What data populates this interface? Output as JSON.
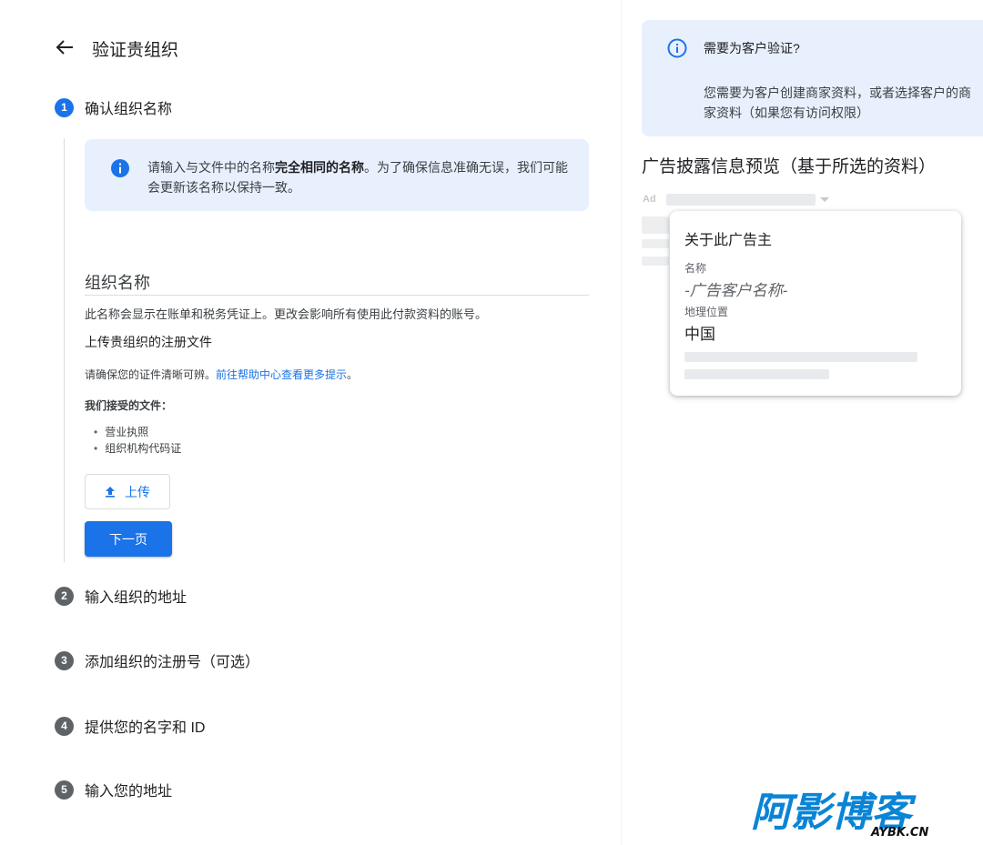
{
  "header": {
    "title": "验证贵组织"
  },
  "steps": [
    {
      "number": "1",
      "label": "确认组织名称"
    },
    {
      "number": "2",
      "label": "输入组织的地址"
    },
    {
      "number": "3",
      "label": "添加组织的注册号（可选）"
    },
    {
      "number": "4",
      "label": "提供您的名字和 ID"
    },
    {
      "number": "5",
      "label": "输入您的地址"
    }
  ],
  "notice": {
    "text_before": "请输入与文件中的名称",
    "text_bold": "完全相同的名称",
    "text_after": "。为了确保信息准确无误，我们可能会更新该名称以保持一致。"
  },
  "form": {
    "field_label": "组织名称",
    "helper": "此名称会显示在账单和税务凭证上。更改会影响所有使用此付款资料的账号。",
    "upload_title": "上传贵组织的注册文件",
    "upload_hint": "请确保您的证件清晰可辨。",
    "upload_hint_link": "前往帮助中心查看更多提示",
    "upload_hint_end": "。",
    "accepted_label": "我们接受的文件：",
    "accepted_docs": [
      "营业执照",
      "组织机构代码证"
    ],
    "upload_button": "上传",
    "next_button": "下一页"
  },
  "help": {
    "title": "需要为客户验证?",
    "body": "您需要为客户创建商家资料，或者选择客户的商家资料（如果您有访问权限）"
  },
  "preview": {
    "title": "广告披露信息预览（基于所选的资料）",
    "ad_tag": "Ad",
    "card_title": "关于此广告主",
    "name_label": "名称",
    "name_value": "-广告客户名称-",
    "location_label": "地理位置",
    "location_value": "中国"
  },
  "watermark": {
    "text": "阿影博客",
    "domain": "AYBK.CN"
  },
  "colors": {
    "accent": "#1a73e8",
    "notice_bg": "#e8f0fe",
    "step_inactive": "#5f6368"
  }
}
